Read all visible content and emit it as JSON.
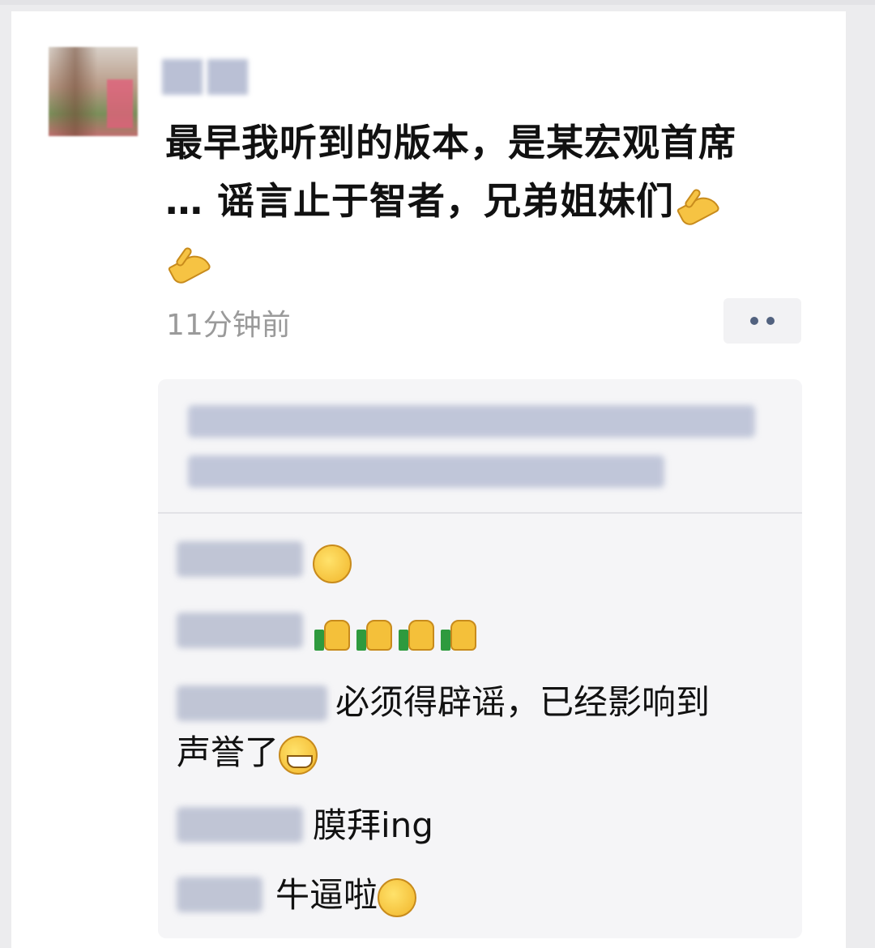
{
  "post": {
    "text_line1": "最早我听到的版本，是某宏观首席",
    "text_line2": "… 谣言止于智者，兄弟姐妹们",
    "emoji_hands_icon": "praying-hands-emoji",
    "timestamp": "11分钟前",
    "more_icon": "more-dots-icon"
  },
  "comments": [
    {
      "text": "",
      "emoji": "face-holding-back-laugh-emoji"
    },
    {
      "text": "",
      "emoji": "thumbs-up-emoji x4"
    },
    {
      "text": "必须得辟谣，已经影响到",
      "text2": "声誉了",
      "emoji": "grinning-face-emoji"
    },
    {
      "text": "膜拜ing"
    },
    {
      "text": "牛逼啦",
      "emoji": "eating-watermelon-face-emoji"
    }
  ],
  "colors": {
    "background": "#ececee",
    "card": "#ffffff",
    "comment_box": "#f5f5f7",
    "timestamp": "#9a9a9a",
    "more_dots": "#52627f"
  }
}
